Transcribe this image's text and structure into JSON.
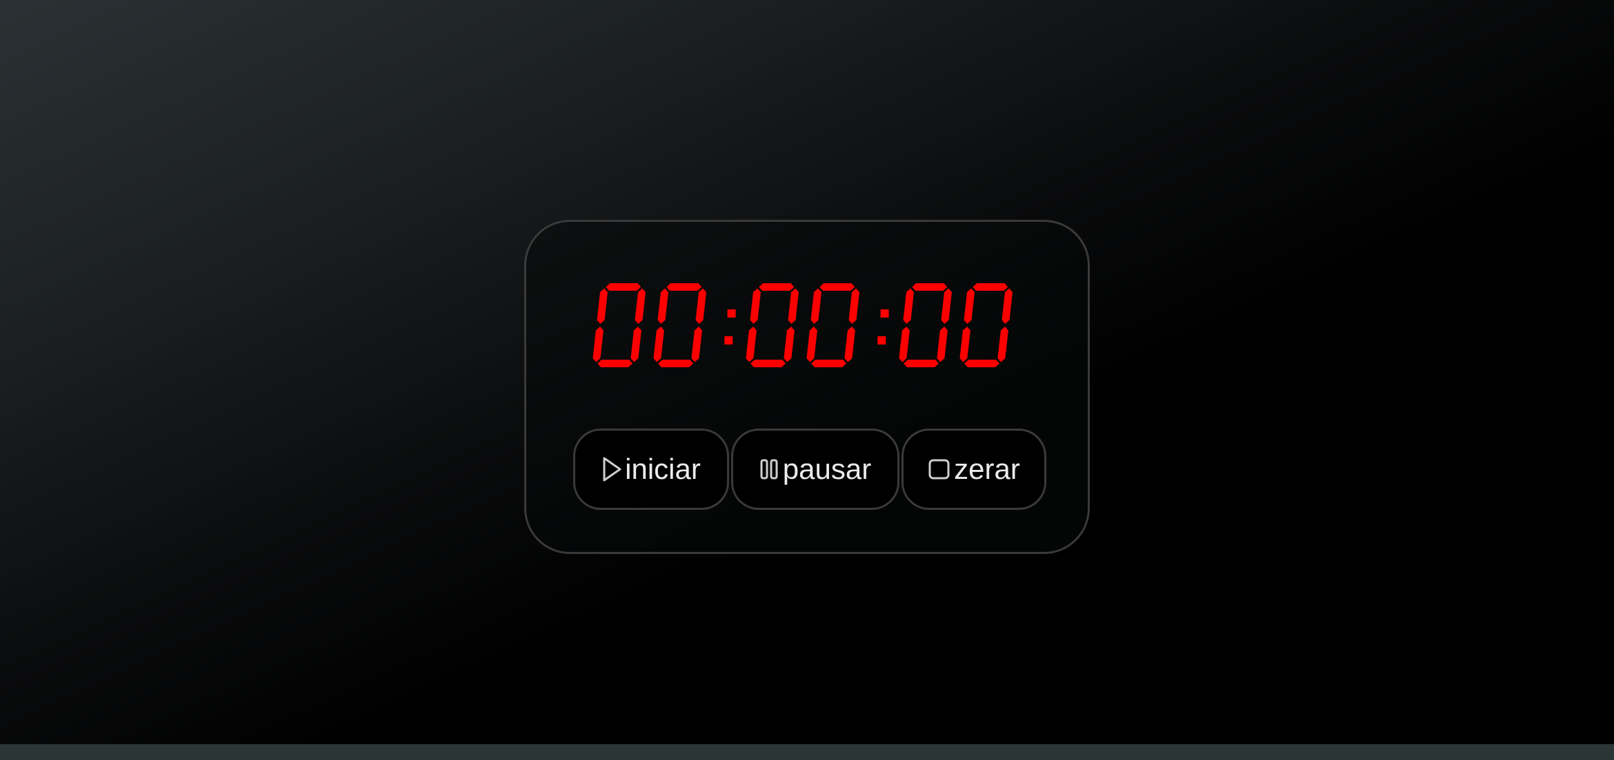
{
  "timer": {
    "display": "00:00:00",
    "digit_color": "#ff0000"
  },
  "controls": {
    "start_label": "iniciar",
    "start_icon": "play-icon",
    "pause_label": "pausar",
    "pause_icon": "pause-icon",
    "reset_label": "zerar",
    "reset_icon": "stop-icon"
  },
  "colors": {
    "border": "#3a3a3a",
    "button_text": "#ececec",
    "footer": "#2c3536"
  }
}
